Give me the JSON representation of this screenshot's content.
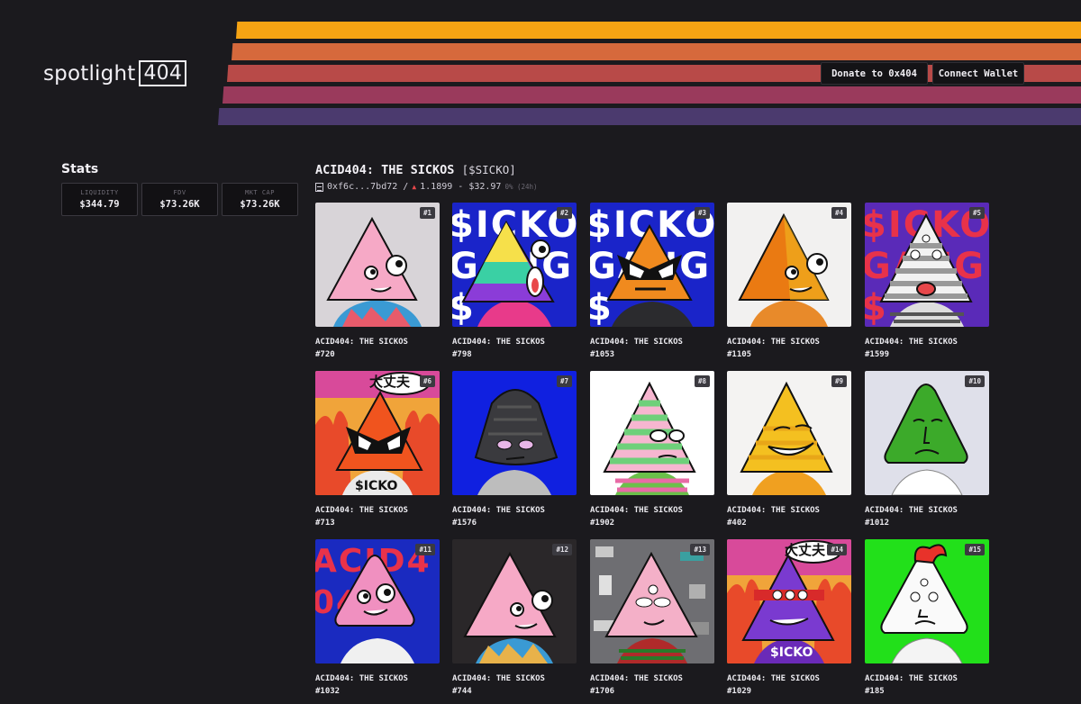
{
  "header": {
    "logo_text": "spotlight",
    "logo_box": "404",
    "donate_label": "Donate to 0x404",
    "connect_label": "Connect Wallet"
  },
  "stats": {
    "title": "Stats",
    "items": [
      {
        "label": "LIQUIDITY",
        "value": "$344.79"
      },
      {
        "label": "FDV",
        "value": "$73.26K"
      },
      {
        "label": "MKT CAP",
        "value": "$73.26K"
      }
    ]
  },
  "collection": {
    "title": "ACID404: THE SICKOS",
    "ticker": "[$SICKO]",
    "address": "0xf6c...7bd72 /",
    "price": "1.1899 - $32.97",
    "change": "0% (24h)"
  },
  "colors": {
    "background": "#1b1a1e",
    "stripes": [
      "#f6a313",
      "#d6693c",
      "#b84a48",
      "#9a3a5c",
      "#4b3a6e"
    ],
    "price_up": "#e8474a"
  },
  "cards": [
    {
      "badge": "#1",
      "name": "ACID404: THE SICKOS",
      "id": "#720"
    },
    {
      "badge": "#2",
      "name": "ACID404: THE SICKOS",
      "id": "#798"
    },
    {
      "badge": "#3",
      "name": "ACID404: THE SICKOS",
      "id": "#1053"
    },
    {
      "badge": "#4",
      "name": "ACID404: THE SICKOS",
      "id": "#1105"
    },
    {
      "badge": "#5",
      "name": "ACID404: THE SICKOS",
      "id": "#1599"
    },
    {
      "badge": "#6",
      "name": "ACID404: THE SICKOS",
      "id": "#713"
    },
    {
      "badge": "#7",
      "name": "ACID404: THE SICKOS",
      "id": "#1576"
    },
    {
      "badge": "#8",
      "name": "ACID404: THE SICKOS",
      "id": "#1902"
    },
    {
      "badge": "#9",
      "name": "ACID404: THE SICKOS",
      "id": "#402"
    },
    {
      "badge": "#10",
      "name": "ACID404: THE SICKOS",
      "id": "#1012"
    },
    {
      "badge": "#11",
      "name": "ACID404: THE SICKOS",
      "id": "#1032"
    },
    {
      "badge": "#12",
      "name": "ACID404: THE SICKOS",
      "id": "#744"
    },
    {
      "badge": "#13",
      "name": "ACID404: THE SICKOS",
      "id": "#1706"
    },
    {
      "badge": "#14",
      "name": "ACID404: THE SICKOS",
      "id": "#1029"
    },
    {
      "badge": "#15",
      "name": "ACID404: THE SICKOS",
      "id": "#185"
    }
  ],
  "artwork": {
    "sicko_text": "$ICKO",
    "gang_text": "GANG$",
    "acid_text": "ACID404",
    "kanji_text": "大丈夫",
    "shirt_text": "$ICKO"
  }
}
